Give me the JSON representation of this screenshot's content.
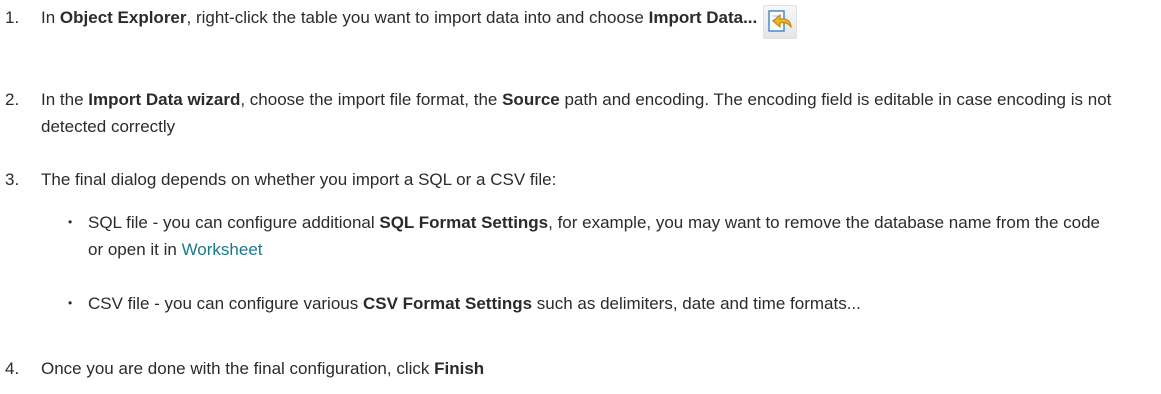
{
  "steps": [
    {
      "number": "1.",
      "t1": "In ",
      "b1": "Object Explorer",
      "t2": ", right-click the table you want to import data into and choose ",
      "b2": "Import Data...",
      "icon": "import-data-icon"
    },
    {
      "number": "2.",
      "t1": "In the ",
      "b1": "Import Data wizard",
      "t2": ", choose the import file format, the ",
      "b2": "Source",
      "t3": " path and encoding. The encoding field is editable in case encoding is not detected correctly"
    },
    {
      "number": "3.",
      "t1": "The final dialog depends on whether you import a SQL or a CSV file:",
      "bullets": [
        {
          "dot": "•",
          "t1": "SQL file - you can configure additional ",
          "b1": "SQL Format Settings",
          "t2": ", for example, you may want to remove the database name from the code or open it in ",
          "link": "Worksheet"
        },
        {
          "dot": "•",
          "t1": "CSV file - you can configure various ",
          "b1": "CSV Format Settings",
          "t2": " such as delimiters, date and time  formats..."
        }
      ]
    },
    {
      "number": "4.",
      "t1": "Once you are done with the final configuration, click ",
      "b1": "Finish"
    }
  ],
  "colors": {
    "text": "#2b2b2b",
    "link": "#1a7a8a"
  }
}
